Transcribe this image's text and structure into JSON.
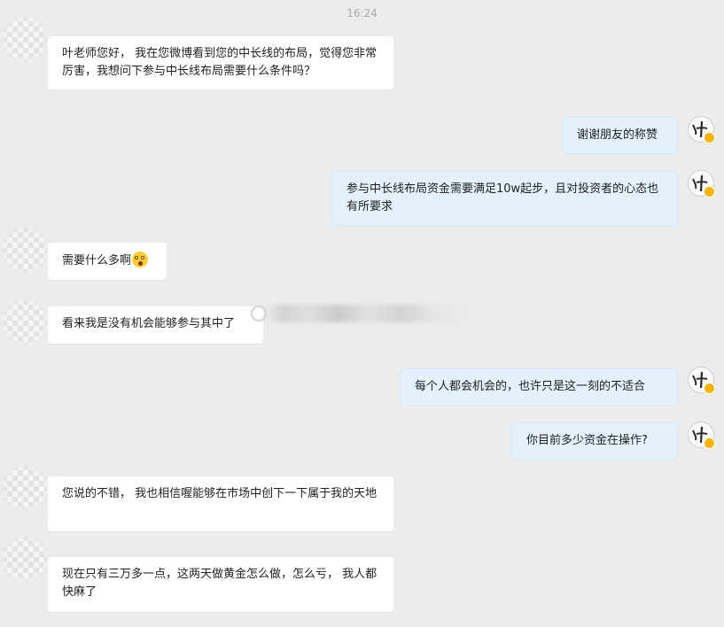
{
  "timestamp": "16:24",
  "messages": [
    {
      "side": "left",
      "text": "叶老师您好， 我在您微博看到您的中长线的布局，觉得您非常厉害，我想问下参与中长线布局需要什么条件吗？"
    },
    {
      "side": "right",
      "text": "谢谢朋友的称赞"
    },
    {
      "side": "right",
      "text": "参与中长线布局资金需要满足10w起步，且对投资者的心态也有所要求"
    },
    {
      "side": "left",
      "text": "需要什么多啊",
      "emoji": "surprised-face-emoji"
    },
    {
      "side": "left",
      "text": "看来我是没有机会能够参与其中了"
    },
    {
      "side": "right",
      "text": "每个人都会机会的，也许只是这一刻的不适合"
    },
    {
      "side": "right",
      "text": "你目前多少资金在操作?"
    },
    {
      "side": "left",
      "text": "您说的不错， 我也相信喔能够在市场中创下一下属于我的天地"
    },
    {
      "side": "left",
      "text": "现在只有三万多一点，这两天做黄金怎么做，怎么亏， 我人都快麻了"
    }
  ],
  "colors": {
    "background": "#ececec",
    "left_bubble": "#ffffff",
    "right_bubble": "#e3f1fc",
    "badge": "#f5b400"
  }
}
